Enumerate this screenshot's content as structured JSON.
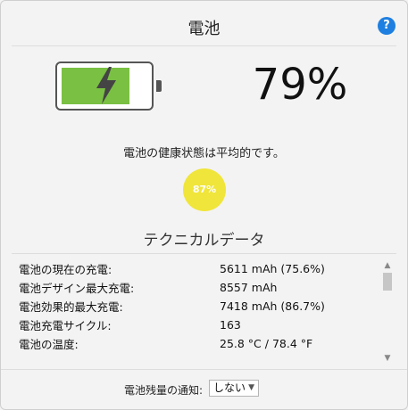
{
  "window": {
    "title": "電池"
  },
  "help": {
    "icon": "question-icon",
    "glyph": "?"
  },
  "battery": {
    "percent_text": "79%",
    "level": 0.79,
    "fill_color": "#7ac043"
  },
  "health": {
    "text": "電池の健康状態は平均的です。",
    "badge": "87%",
    "badge_color": "#f0e53a"
  },
  "technical": {
    "title": "テクニカルデータ",
    "rows": [
      {
        "label": "電池の現在の充電:",
        "value": "5611 mAh (75.6%)"
      },
      {
        "label": "電池デザイン最大充電:",
        "value": "8557 mAh"
      },
      {
        "label": "電池効果的最大充電:",
        "value": "7418 mAh (86.7%)"
      },
      {
        "label": "電池充電サイクル:",
        "value": "163"
      },
      {
        "label": "電池の温度:",
        "value": "25.8 °C / 78.4 °F"
      }
    ]
  },
  "notify": {
    "label": "電池残量の通知:",
    "selected": "しない"
  }
}
